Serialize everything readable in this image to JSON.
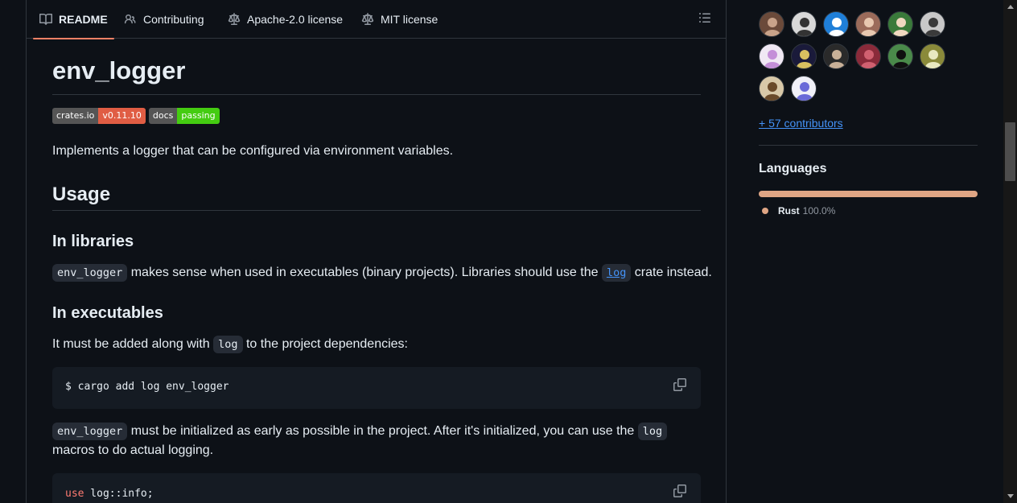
{
  "tabs": [
    {
      "label": "README",
      "icon": "book-icon",
      "active": true
    },
    {
      "label": "Contributing",
      "icon": "people-icon"
    },
    {
      "label": "Apache-2.0 license",
      "icon": "law-icon"
    },
    {
      "label": "MIT license",
      "icon": "law-icon"
    }
  ],
  "readme": {
    "title": "env_logger",
    "badges": [
      {
        "label": "crates.io",
        "value": "v0.11.10",
        "color": "#e05d44"
      },
      {
        "label": "docs",
        "value": "passing",
        "color": "#4c1"
      }
    ],
    "intro": "Implements a logger that can be configured via environment variables.",
    "usage_heading": "Usage",
    "libraries_heading": "In libraries",
    "libraries_code": "env_logger",
    "libraries_text_1": " makes sense when used in executables (binary projects). Libraries should use the ",
    "libraries_link": "log",
    "libraries_text_2": " crate instead.",
    "executables_heading": "In executables",
    "exec_text_1": "It must be added along with ",
    "exec_code": "log",
    "exec_text_2": " to the project dependencies:",
    "code_block_1": "$ cargo add log env_logger",
    "init_code": "env_logger",
    "init_text_1": " must be initialized as early as possible in the project. After it's initialized, you can use the ",
    "init_code_2": "log",
    "init_text_2": "macros to do actual logging.",
    "code_block_2_kw": "use",
    "code_block_2_rest": " log::info;"
  },
  "sidebar": {
    "avatars": [
      {
        "bg": "#6b4a3a",
        "fg": "#c9a38a"
      },
      {
        "bg": "#d8d8d8",
        "fg": "#333333"
      },
      {
        "bg": "#1f7fd8",
        "fg": "#ffffff"
      },
      {
        "bg": "#9b6b5a",
        "fg": "#e8c8b0"
      },
      {
        "bg": "#3a7a3a",
        "fg": "#f0d8c0"
      },
      {
        "bg": "#c8c8c8",
        "fg": "#3a3a3a"
      },
      {
        "bg": "#f0e8f4",
        "fg": "#c48fd8"
      },
      {
        "bg": "#1a1a3a",
        "fg": "#d8c060"
      },
      {
        "bg": "#2a2a2a",
        "fg": "#c8b098"
      },
      {
        "bg": "#8a2a3a",
        "fg": "#d06070"
      },
      {
        "bg": "#4a8a4a",
        "fg": "#101010"
      },
      {
        "bg": "#8a8a3a",
        "fg": "#e8e8c0"
      },
      {
        "bg": "#d8c8a8",
        "fg": "#6a4a2a"
      },
      {
        "bg": "#f0f0f8",
        "fg": "#6a6ad8"
      }
    ],
    "contributors_link": "+ 57 contributors",
    "languages_title": "Languages",
    "languages": [
      {
        "name": "Rust",
        "percent": "100.0%",
        "fraction": 1.0,
        "color": "#dea584"
      }
    ]
  }
}
